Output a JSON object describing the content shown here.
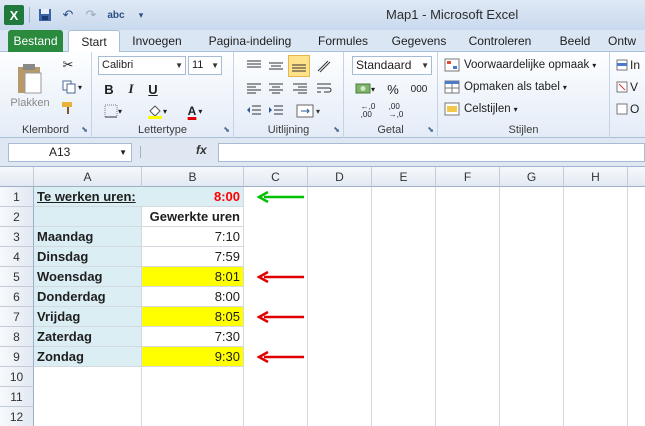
{
  "window": {
    "title": "Map1  -  Microsoft Excel"
  },
  "qat": {
    "app_icon": "X",
    "undo": "↶",
    "redo": "↷",
    "spell": "abc"
  },
  "tabs": [
    "Bestand",
    "Start",
    "Invoegen",
    "Pagina-indeling",
    "Formules",
    "Gegevens",
    "Controleren",
    "Beeld",
    "Ontw"
  ],
  "ribbon": {
    "klembord": {
      "label": "Klembord",
      "paste": "Plakken"
    },
    "lettertype": {
      "label": "Lettertype",
      "font": "Calibri",
      "size": "11",
      "bold": "B",
      "italic": "I",
      "underline": "U",
      "fontcolor": "A"
    },
    "uitlijning": {
      "label": "Uitlijning"
    },
    "getal": {
      "label": "Getal",
      "format": "Standaard",
      "percent": "%",
      "thousands": "000"
    },
    "stijlen": {
      "label": "Stijlen",
      "cond": "Voorwaardelijke opmaak",
      "table": "Opmaken als tabel",
      "cell": "Celstijlen"
    },
    "cellen": {
      "insert": "In",
      "delete": "V",
      "format": "O"
    }
  },
  "formula_bar": {
    "name_box": "A13",
    "fx": "fx",
    "content": ""
  },
  "columns": [
    "A",
    "B",
    "C",
    "D",
    "E",
    "F",
    "G",
    "H"
  ],
  "rows": [
    "1",
    "2",
    "3",
    "4",
    "5",
    "6",
    "7",
    "8",
    "9",
    "10",
    "11",
    "12"
  ],
  "cells": {
    "A1": "Te werken uren:",
    "B1": "8:00",
    "B2": "Gewerkte uren",
    "A3": "Maandag",
    "B3": "7:10",
    "A4": "Dinsdag",
    "B4": "7:59",
    "A5": "Woensdag",
    "B5": "8:01",
    "A6": "Donderdag",
    "B6": "8:00",
    "A7": "Vrijdag",
    "B7": "8:05",
    "A8": "Zaterdag",
    "B8": "7:30",
    "A9": "Zondag",
    "B9": "9:30"
  },
  "colors": {
    "light_blue": "#daeef3",
    "yellow": "#ffff00",
    "red_text": "#ff0000",
    "green_arrow": "#00c000",
    "red_arrow": "#e00000"
  }
}
